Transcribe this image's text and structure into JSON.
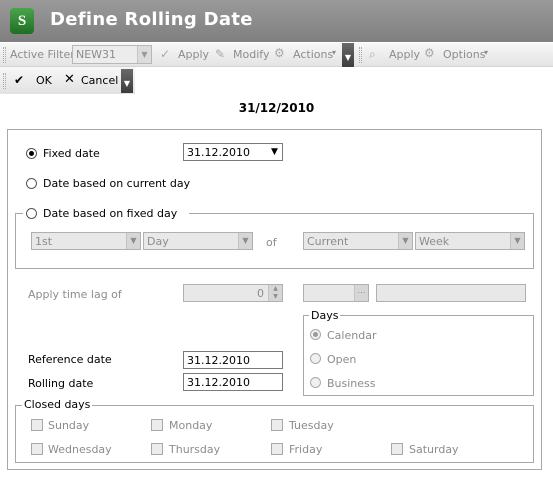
{
  "window": {
    "title": "Define Rolling Date",
    "logo_letter": "S"
  },
  "toolbar1": {
    "active_filter_label": "Active Filter",
    "active_filter_value": "NEW31",
    "apply_label": "Apply",
    "modify_label": "Modify",
    "actions_label": "Actions",
    "apply2_label": "Apply",
    "options_label": "Options"
  },
  "toolbar2": {
    "ok_label": "OK",
    "cancel_label": "Cancel"
  },
  "current_date": "31/12/2010",
  "options": {
    "fixed_date_label": "Fixed date",
    "fixed_date_value": "31.12.2010",
    "current_day_label": "Date based on current day",
    "fixed_day_label": "Date based on fixed day",
    "selected": "fixed_date"
  },
  "fixed_day": {
    "ordinal": "1st",
    "unit": "Day",
    "of_label": "of",
    "period": "Current",
    "period_unit": "Week"
  },
  "time_lag": {
    "label": "Apply time lag of",
    "value": "0",
    "unit": "",
    "text": ""
  },
  "days": {
    "title": "Days",
    "calendar_label": "Calendar",
    "open_label": "Open",
    "business_label": "Business",
    "selected": "calendar"
  },
  "reference_date": {
    "label": "Reference date",
    "value": "31.12.2010"
  },
  "rolling_date": {
    "label": "Rolling date",
    "value": "31.12.2010"
  },
  "closed_days": {
    "title": "Closed days",
    "days": [
      "Sunday",
      "Monday",
      "Tuesday",
      "Wednesday",
      "Thursday",
      "Friday",
      "Saturday"
    ]
  }
}
